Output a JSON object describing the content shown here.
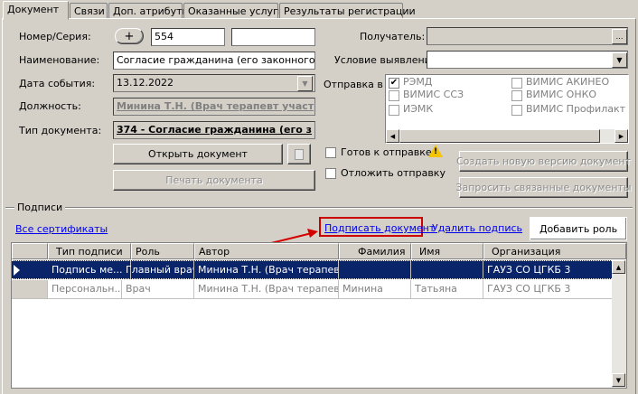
{
  "tabs": [
    {
      "label": "Документ"
    },
    {
      "label": "Связи"
    },
    {
      "label": "Доп. атрибуты"
    },
    {
      "label": "Оказанные услуги"
    },
    {
      "label": "Результаты регистрации"
    }
  ],
  "form": {
    "number_label": "Номер/Серия:",
    "number_plus": "+",
    "number_value": "554",
    "series_value": "",
    "name_label": "Наименование:",
    "name_value": "Согласие гражданина (его законного или у",
    "date_label": "Дата события:",
    "date_value": "13.12.2022",
    "position_label": "Должность:",
    "position_value": "Минина Т.Н. (Врач терапевт участ",
    "doctype_label": "Тип документа:",
    "doctype_value": "374 - Согласие гражданина (его з",
    "recipient_label": "Получатель:",
    "recipient_value": "",
    "condition_label": "Условие выявления:",
    "condition_value": "",
    "send_label": "Отправка в"
  },
  "send_targets": [
    {
      "label": "РЭМД",
      "checked": true
    },
    {
      "label": "ВИМИС АКИНЕО",
      "checked": false
    },
    {
      "label": "ВИМИС ССЗ",
      "checked": false
    },
    {
      "label": "ВИМИС ОНКО",
      "checked": false
    },
    {
      "label": "ИЭМК",
      "checked": false
    },
    {
      "label": "ВИМИС Профилактика",
      "checked": false
    }
  ],
  "buttons": {
    "open_doc": "Открыть документ",
    "print_doc": "Печать документа",
    "create_version": "Создать новую версию документ",
    "request_linked": "Запросить связанные документы",
    "add_role": "Добавить роль"
  },
  "checks": {
    "ready_label": "Готов к отправке",
    "postpone_label": "Отложить отправку"
  },
  "signatures": {
    "group_label": "Подписи",
    "all_certs": "Все сертификаты",
    "sign_doc": "Подписать документ",
    "remove_sign": "Удалить подпись",
    "columns": [
      "Тип подписи",
      "Роль",
      "Автор",
      "Фамилия",
      "Имя",
      "Организация"
    ],
    "rows": [
      {
        "type": "Подпись ме...",
        "role": "Главный врач",
        "author": "Минина Т.Н. (Врач терапевт ...",
        "last": "",
        "first": "",
        "org": "ГАУЗ СО ЦГКБ 3",
        "selected": true
      },
      {
        "type": "Персональн...",
        "role": "Врач",
        "author": "Минина Т.Н. (Врач терапевт ...",
        "last": "Минина",
        "first": "Татьяна",
        "org": "ГАУЗ СО ЦГКБ 3",
        "selected": false
      }
    ]
  },
  "colors": {
    "selection": "#0a246a",
    "highlight_border": "#cc0000",
    "arrow": "#d40000"
  }
}
